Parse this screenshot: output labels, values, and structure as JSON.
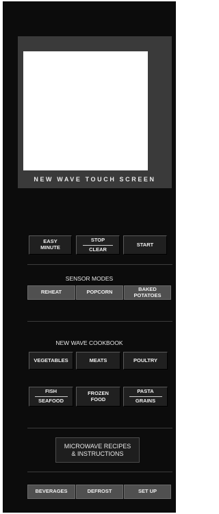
{
  "screen": {
    "label": "NEW WAVE TOUCH SCREEN"
  },
  "top_buttons": {
    "easy": [
      "EASY",
      "MINUTE"
    ],
    "stop": [
      "STOP",
      "CLEAR"
    ],
    "start": "START"
  },
  "sensor": {
    "heading": "SENSOR MODES",
    "reheat": "REHEAT",
    "popcorn": "POPCORN",
    "baked": [
      "BAKED",
      "POTATOES"
    ]
  },
  "cookbook": {
    "heading": "NEW WAVE COOKBOOK",
    "vegetables": "VEGETABLES",
    "meats": "MEATS",
    "poultry": "POULTRY",
    "fish": [
      "FISH",
      "SEAFOOD"
    ],
    "frozen": [
      "FROZEN",
      "FOOD"
    ],
    "pasta": [
      "PASTA",
      "GRAINS"
    ]
  },
  "recipes": [
    "MICROWAVE RECIPES",
    "& INSTRUCTIONS"
  ],
  "bottom": {
    "beverages": "BEVERAGES",
    "defrost": "DEFROST",
    "setup": "SET UP"
  }
}
